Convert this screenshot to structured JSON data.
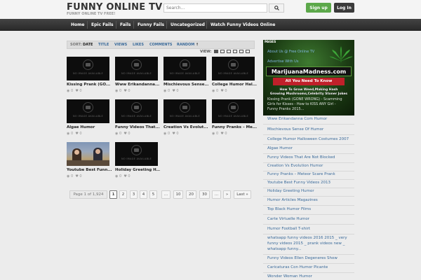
{
  "header": {
    "logo": "FUNNY ONLINE TV",
    "tagline": "FUNNY ONLINE TV FREE!",
    "search_placeholder": "Search...",
    "signup": "Sign up",
    "login": "Log In"
  },
  "nav": [
    "Home",
    "Epic Fails",
    "Fails",
    "Funny Fails",
    "Uncategorized",
    "Watch Funny Videos Online"
  ],
  "sort": {
    "label": "SORT:",
    "options": [
      "DATE",
      "TITLE",
      "VIEWS",
      "LIKES",
      "COMMENTS",
      "RANDOM"
    ],
    "arrow": "🠕",
    "view_label": "VIEW:"
  },
  "no_image_text": "NO IMAGE AVAILABLE",
  "videos": [
    {
      "title": "Kissing Prank (GO...",
      "views": "0",
      "likes": "0"
    },
    {
      "title": "Www Erikandanna...",
      "views": "0",
      "likes": "0"
    },
    {
      "title": "Mischievous Sense...",
      "views": "0",
      "likes": "0"
    },
    {
      "title": "College Humor Hal...",
      "views": "0",
      "likes": "0"
    },
    {
      "title": "Algae Humor",
      "views": "0",
      "likes": "0"
    },
    {
      "title": "Funny Videos That...",
      "views": "0",
      "likes": "0"
    },
    {
      "title": "Creation Vs Evolut...",
      "views": "0",
      "likes": "0"
    },
    {
      "title": "Funny Pranks – Me...",
      "views": "0",
      "likes": "0"
    },
    {
      "title": "Youtube Best Funn...",
      "views": "0",
      "likes": "0"
    },
    {
      "title": "Holiday Greeting H...",
      "views": "0",
      "likes": "0"
    }
  ],
  "pagination": {
    "info": "Page 1 of 1,924",
    "pages": [
      "1",
      "2",
      "3",
      "4",
      "5",
      "...",
      "10",
      "20",
      "30",
      "...",
      "»",
      "Last »"
    ]
  },
  "sidebar": {
    "pages_label": "PAGES",
    "banner": {
      "title": "MarijuanaMadness.com",
      "subtitle": "All You Need To Know",
      "line1": "How To Grow Weed,Making Hash",
      "line2": "Growing Mushrooms,Celebrity Stoner Jokes",
      "overlay_links": [
        "About Us @ Free Online TV",
        "Advertise With Us"
      ],
      "overlay_item1": "Kissing Prank (GONE WRONG) - Scamming",
      "overlay_item2": "Girls for Kisses - How to KISS ANY Girl -",
      "overlay_item3": "Funny Pranks 2015..."
    },
    "items": [
      "Www Erikandanna Com Humor",
      "Mischievous Sense Of Humor",
      "College Humor Halloween Costumes 2007",
      "Algae Humor",
      "Funny Videos That Are Not Blocked",
      "Creation Vs Evolution Humor",
      "Funny Pranks – Meteor Scare Prank",
      "Youtube Best Funny Videos 2013",
      "Holiday Greeting Humor",
      "Humor Articles Magazines",
      "Top Black Humor Films",
      "Carte Virtuelle Humor",
      "Humor Football T-shirt",
      "whatsapp funny videos 2016 2015 _ very",
      "funny videos 2015 _ prank videos new _",
      "whatsapp funny...",
      "Funny Videos Ellen Degeneres Show",
      "Caricaturas Con Humor Picante",
      "Wonder Woman Humor"
    ]
  },
  "colors": {
    "signup": "#5ca84a",
    "login": "#3a3a3a",
    "nav_bg": "#333333",
    "link": "#3a6a9a"
  }
}
